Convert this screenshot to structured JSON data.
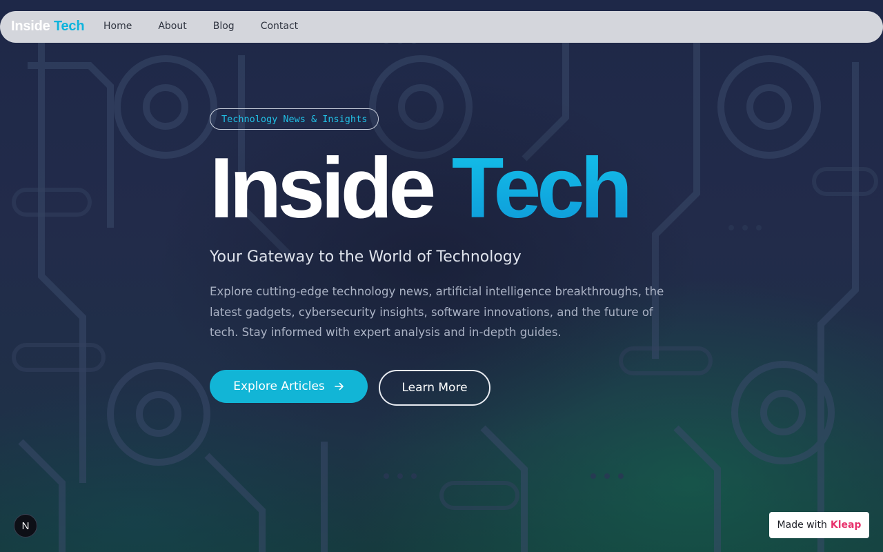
{
  "nav": {
    "logo_part1": "Inside",
    "logo_part2": "Tech",
    "links": [
      "Home",
      "About",
      "Blog",
      "Contact"
    ]
  },
  "hero": {
    "badge": "Technology News & Insights",
    "title_part1": "Inside",
    "title_part2": "Tech",
    "subtitle": "Your Gateway to the World of Technology",
    "description": "Explore cutting-edge technology news, artificial intelligence breakthroughs, the latest gadgets, cybersecurity insights, software innovations, and the future of tech. Stay informed with expert analysis and in-depth guides.",
    "primary_button": "Explore Articles",
    "primary_button_icon": "arrow-right-icon",
    "secondary_button": "Learn More"
  },
  "footer": {
    "n_badge": "N",
    "made_with": "Made with",
    "made_with_brand": "Kleap"
  },
  "colors": {
    "accent": "#12b5d6",
    "brand_pink": "#e8336d",
    "background": "#1e2848"
  }
}
